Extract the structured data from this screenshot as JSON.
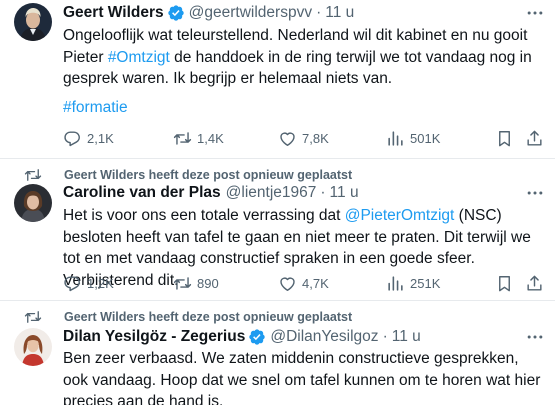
{
  "tweets": [
    {
      "name": "Geert Wilders",
      "handle": "@geertwilderspvv",
      "dot": "·",
      "time": "11 u",
      "text_parts": [
        "Ongelooflijk wat teleurstellend. Nederland wil dit kabinet en nu gooit Pieter ",
        "#Omtzigt",
        " de handdoek in de ring terwijl we tot vandaag nog in gesprek waren. Ik begrijp er helemaal niets van."
      ],
      "hashtag_line": "#formatie",
      "replies": "2,1K",
      "reposts": "1,4K",
      "likes": "7,8K",
      "views": "501K"
    },
    {
      "repost_label": "Geert Wilders heeft deze post opnieuw geplaatst",
      "name": "Caroline van der Plas",
      "handle": "@lientje1967",
      "dot": "·",
      "time": "11 u",
      "text_parts": [
        "Het is voor ons een totale verrassing dat ",
        "@PieterOmtzigt",
        " (NSC) besloten heeft van tafel te gaan en niet meer te praten. Dit terwijl we tot en met vandaag constructief spraken in een goede sfeer. Verbijsterend dit."
      ],
      "replies": "1,2K",
      "reposts": "890",
      "likes": "4,7K",
      "views": "251K"
    },
    {
      "repost_label": "Geert Wilders heeft deze post opnieuw geplaatst",
      "name": "Dilan Yesilgöz - Zegerius",
      "handle": "@DilanYesilgoz",
      "dot": "·",
      "time": "11 u",
      "text": "Ben zeer verbaasd. We zaten middenin constructieve gesprekken, ook vandaag. Hoop dat we snel om tafel kunnen om te horen wat hier precies aan de hand is."
    }
  ],
  "colors": {
    "link": "#1d9bf0",
    "verified": "#1d9bf0",
    "secondary_text": "#536471",
    "divider": "#e7eaed"
  },
  "icons": [
    "retweet-icon",
    "verified-badge-icon",
    "more-icon",
    "reply-icon",
    "like-icon",
    "views-icon",
    "bookmark-icon",
    "share-icon"
  ]
}
